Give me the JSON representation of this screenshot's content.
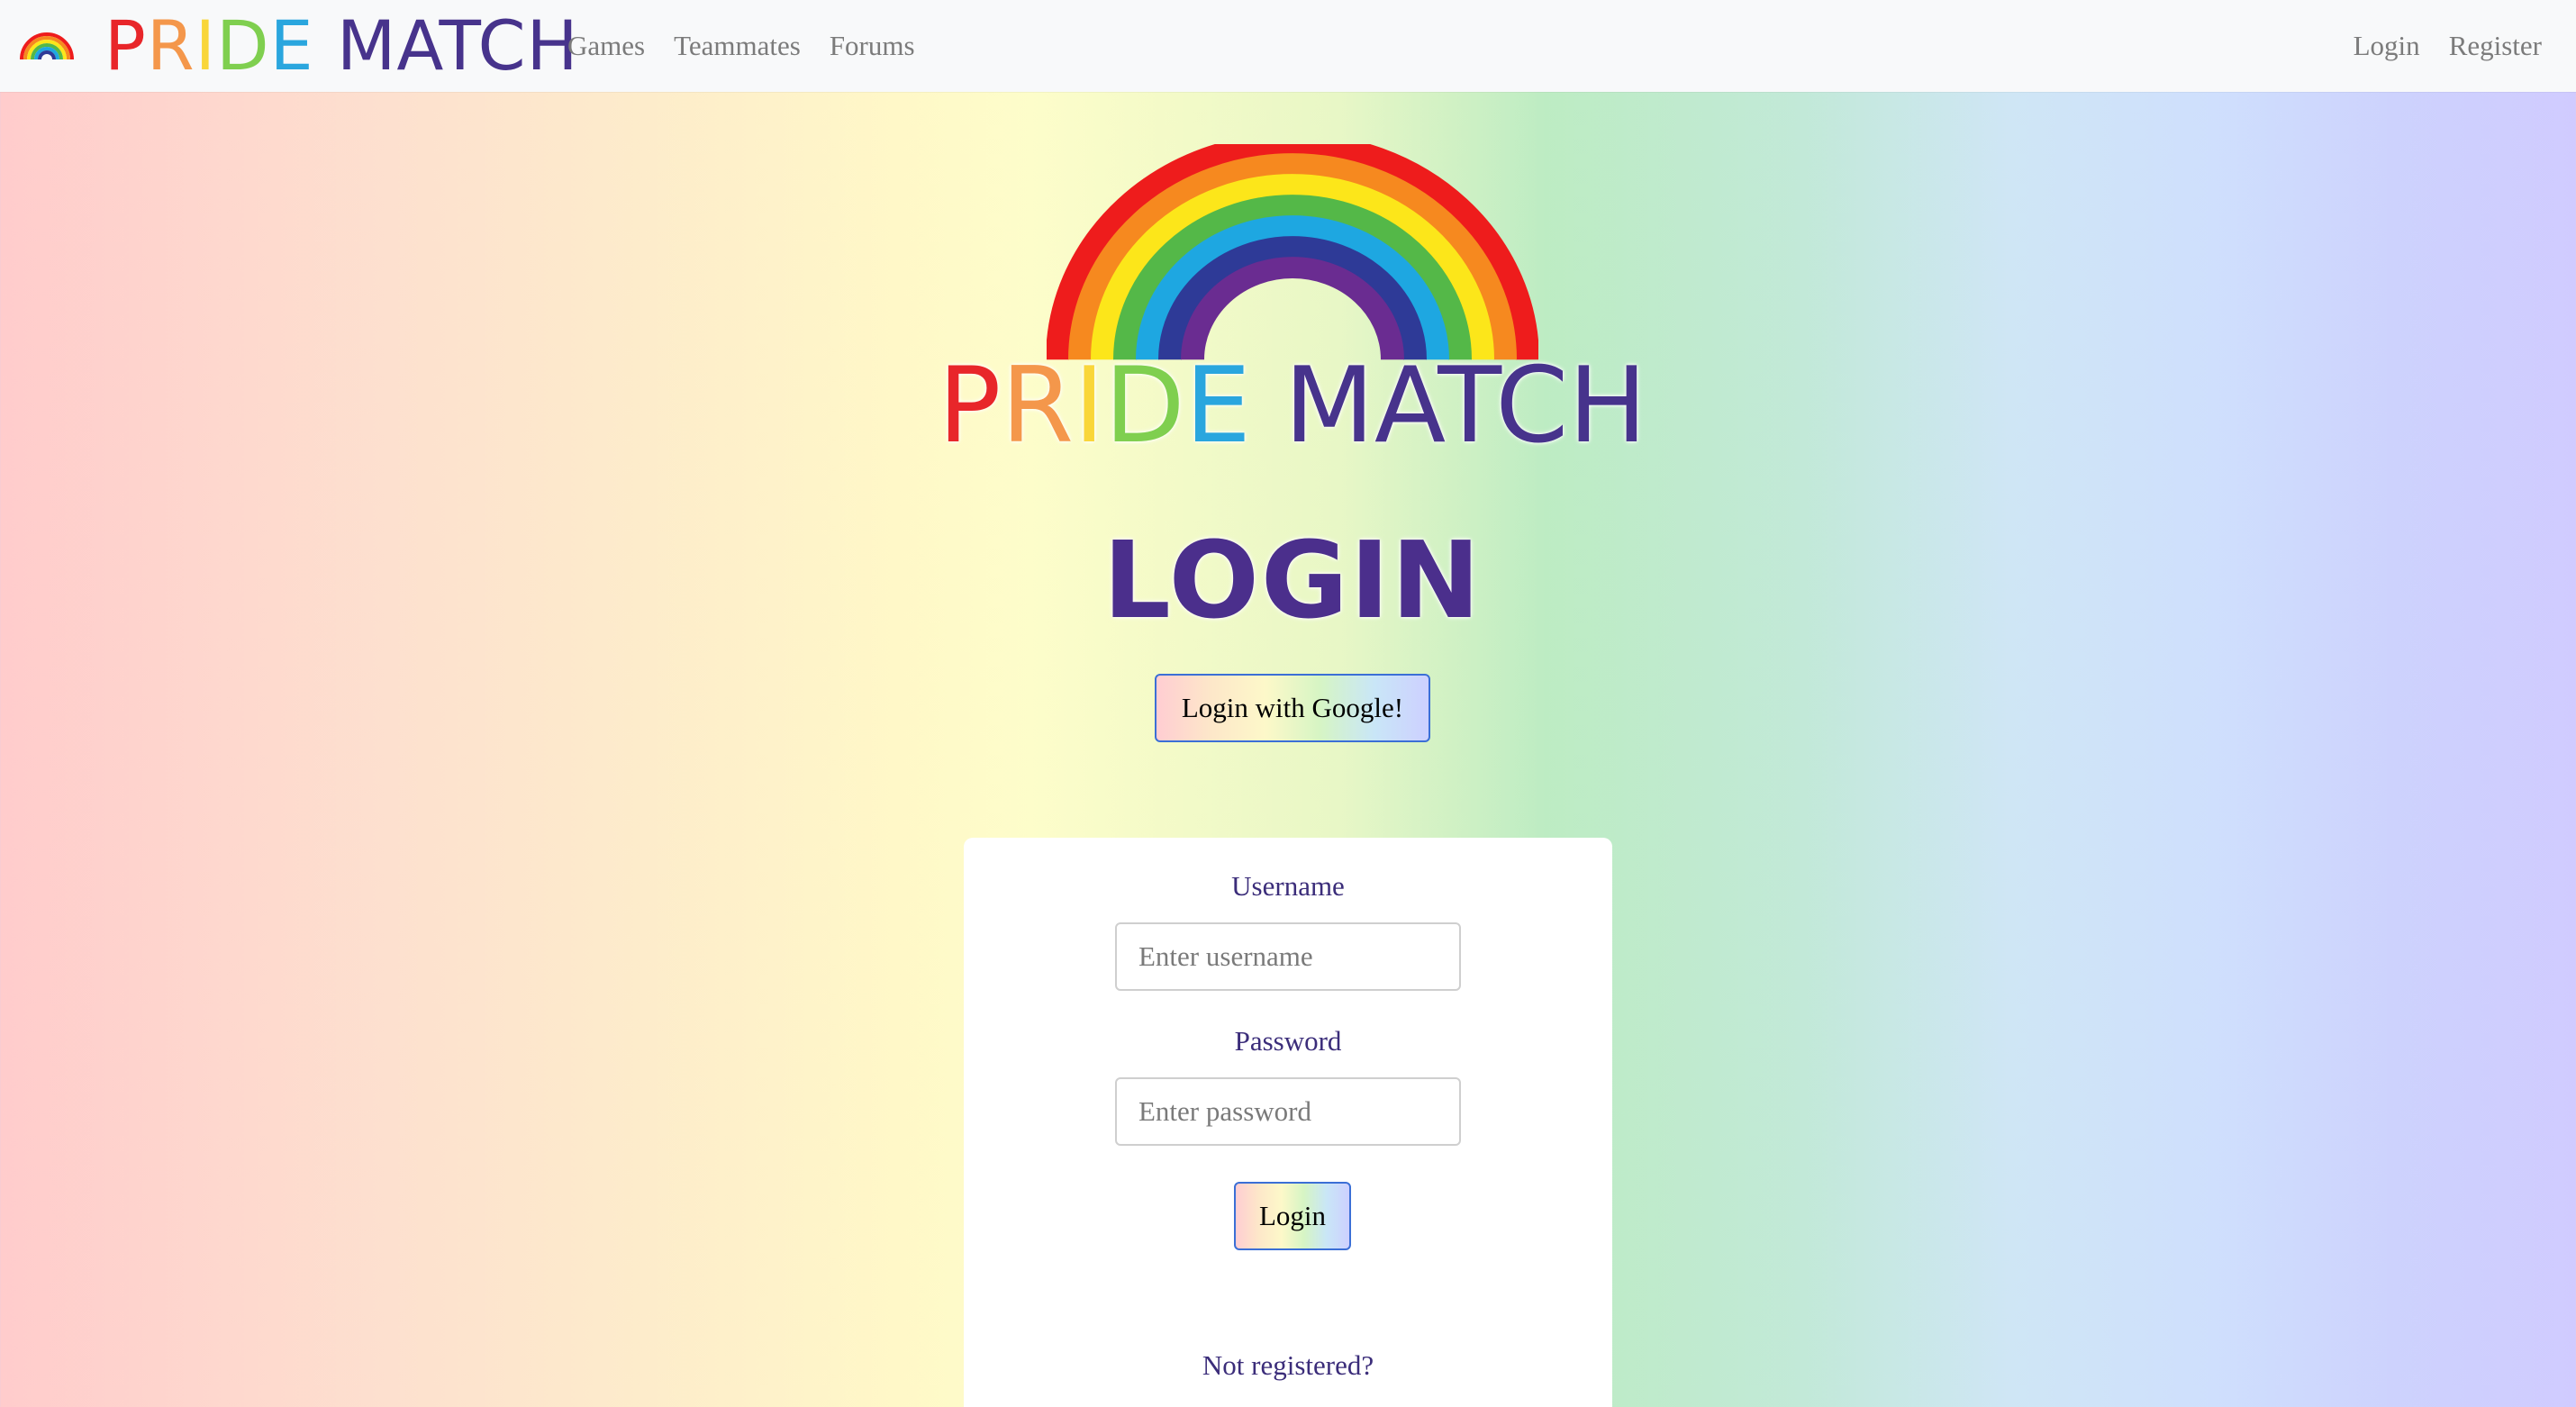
{
  "navbar": {
    "brand_pride": [
      "P",
      "R",
      "I",
      "D",
      "E"
    ],
    "brand_match": "MATCH",
    "links": [
      "Games",
      "Teammates",
      "Forums"
    ],
    "right_links": [
      "Login",
      "Register"
    ]
  },
  "hero": {
    "wordmark_pride": [
      "P",
      "R",
      "I",
      "D",
      "E"
    ],
    "wordmark_match": "MATCH",
    "heading": "LOGIN"
  },
  "google_button": "Login with Google!",
  "form": {
    "username_label": "Username",
    "username_placeholder": "Enter username",
    "password_label": "Password",
    "password_placeholder": "Enter password",
    "submit_label": "Login",
    "not_registered": "Not registered?"
  },
  "colors": {
    "pride_letters": [
      "#e8262a",
      "#f4974b",
      "#f9d63a",
      "#7fcf4f",
      "#2aa6de"
    ],
    "match": "#47338c",
    "rainbow": [
      "#ee1c1c",
      "#f6891f",
      "#fce61a",
      "#54b848",
      "#1ea7e1",
      "#2e3a97",
      "#6a2c91"
    ]
  }
}
